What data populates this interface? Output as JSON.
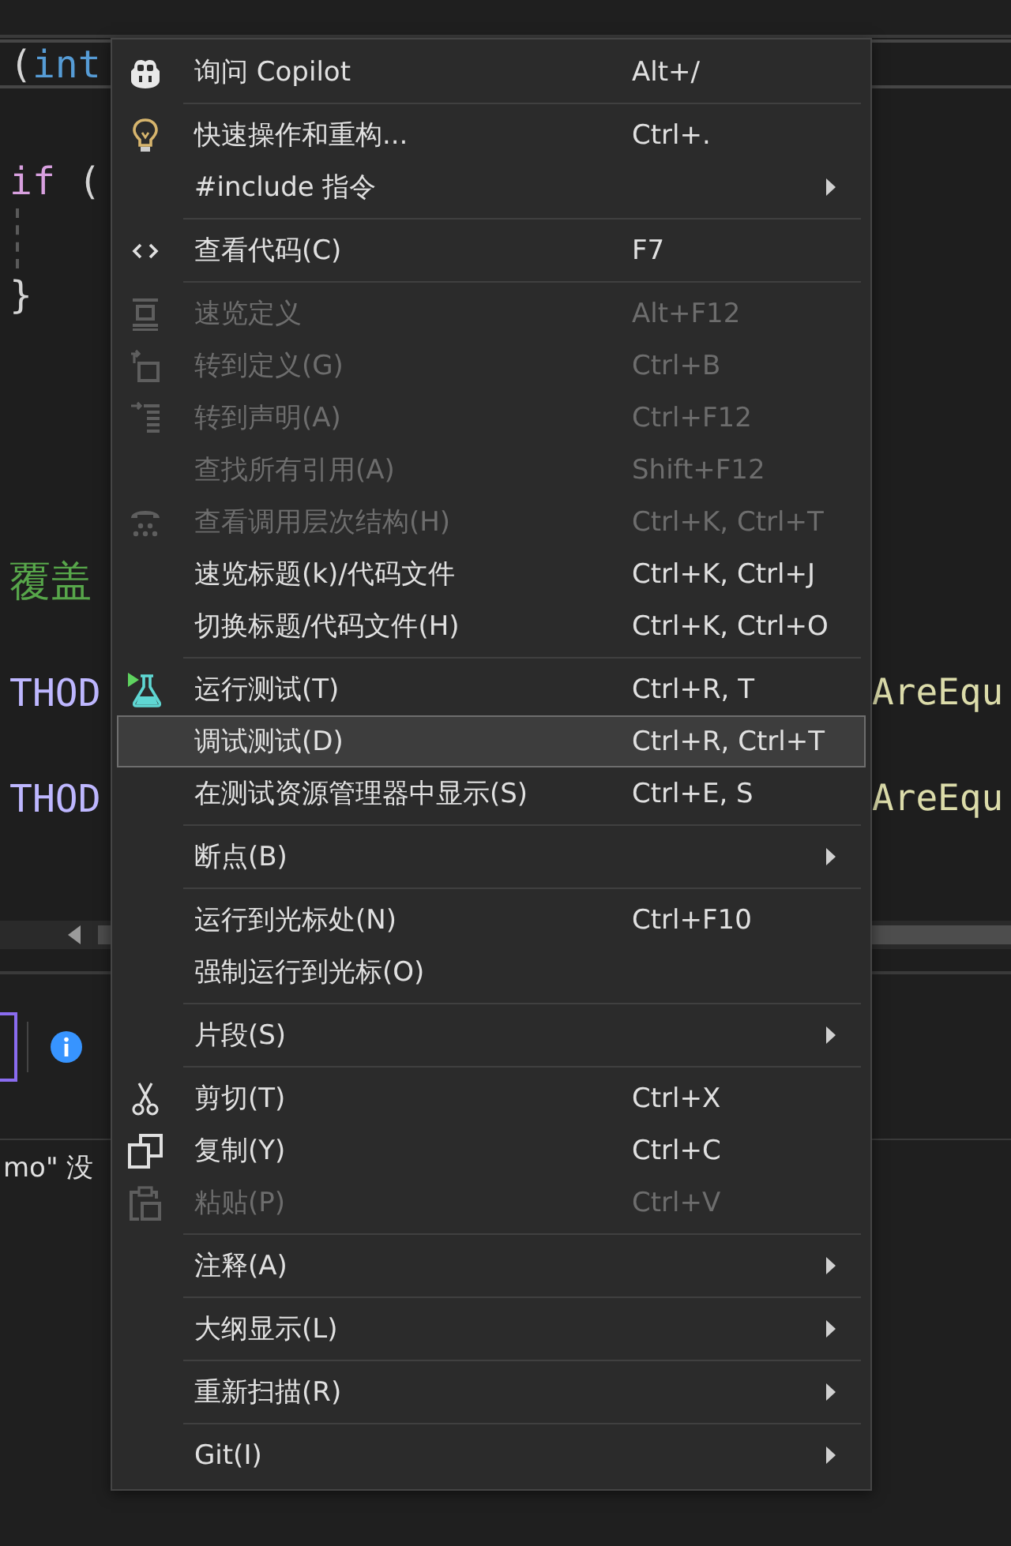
{
  "editor": {
    "lines": [
      {
        "left": [
          {
            "text": "(",
            "kind": "punct"
          },
          {
            "text": "int",
            "kind": "type"
          }
        ],
        "current": true
      },
      {
        "left": [
          {
            "text": "if",
            "kind": "keyword"
          },
          {
            "text": " (",
            "kind": "punct"
          }
        ],
        "current": false
      },
      {
        "left": [
          {
            "text": "}",
            "kind": "punct"
          }
        ],
        "current": false
      },
      {
        "left": [
          {
            "text": "覆盖",
            "kind": "comment"
          }
        ],
        "current": false
      },
      {
        "left": [
          {
            "text": "THOD",
            "kind": "macro"
          }
        ],
        "right": [
          {
            "text": "AreEqu",
            "kind": "function"
          }
        ],
        "current": false
      },
      {
        "left": [
          {
            "text": "THOD",
            "kind": "macro"
          }
        ],
        "right": [
          {
            "text": "AreEqu",
            "kind": "function"
          }
        ],
        "current": false
      }
    ]
  },
  "output_panel": {
    "message": "mo\" 没"
  },
  "context_menu": {
    "groups": [
      {
        "items": [
          {
            "label": "询问 Copilot",
            "shortcut": "Alt+/",
            "disabled": false,
            "selected": false,
            "has_submenu": false
          }
        ]
      },
      {
        "items": [
          {
            "label": "快速操作和重构...",
            "shortcut": "Ctrl+.",
            "disabled": false,
            "selected": false,
            "has_submenu": false
          },
          {
            "label": "#include 指令",
            "disabled": false,
            "selected": false,
            "has_submenu": true
          }
        ]
      },
      {
        "items": [
          {
            "label": "查看代码(C)",
            "shortcut": "F7",
            "disabled": false,
            "selected": false,
            "has_submenu": false
          }
        ]
      },
      {
        "items": [
          {
            "label": "速览定义",
            "shortcut": "Alt+F12",
            "disabled": true,
            "selected": false,
            "has_submenu": false
          },
          {
            "label": "转到定义(G)",
            "shortcut": "Ctrl+B",
            "disabled": true,
            "selected": false,
            "has_submenu": false
          },
          {
            "label": "转到声明(A)",
            "shortcut": "Ctrl+F12",
            "disabled": true,
            "selected": false,
            "has_submenu": false
          },
          {
            "label": "查找所有引用(A)",
            "shortcut": "Shift+F12",
            "disabled": true,
            "selected": false,
            "has_submenu": false
          },
          {
            "label": "查看调用层次结构(H)",
            "shortcut": "Ctrl+K, Ctrl+T",
            "disabled": true,
            "selected": false,
            "has_submenu": false
          },
          {
            "label": "速览标题(k)/代码文件",
            "shortcut": "Ctrl+K, Ctrl+J",
            "disabled": false,
            "selected": false,
            "has_submenu": false
          },
          {
            "label": "切换标题/代码文件(H)",
            "shortcut": "Ctrl+K, Ctrl+O",
            "disabled": false,
            "selected": false,
            "has_submenu": false
          }
        ]
      },
      {
        "items": [
          {
            "label": "运行测试(T)",
            "shortcut": "Ctrl+R, T",
            "disabled": false,
            "selected": false,
            "has_submenu": false
          },
          {
            "label": "调试测试(D)",
            "shortcut": "Ctrl+R, Ctrl+T",
            "disabled": false,
            "selected": true,
            "has_submenu": false
          },
          {
            "label": "在测试资源管理器中显示(S)",
            "shortcut": "Ctrl+E, S",
            "disabled": false,
            "selected": false,
            "has_submenu": false
          }
        ]
      },
      {
        "items": [
          {
            "label": "断点(B)",
            "disabled": false,
            "selected": false,
            "has_submenu": true
          }
        ]
      },
      {
        "items": [
          {
            "label": "运行到光标处(N)",
            "shortcut": "Ctrl+F10",
            "disabled": false,
            "selected": false,
            "has_submenu": false
          },
          {
            "label": "强制运行到光标(O)",
            "disabled": false,
            "selected": false,
            "has_submenu": false
          }
        ]
      },
      {
        "items": [
          {
            "label": "片段(S)",
            "disabled": false,
            "selected": false,
            "has_submenu": true
          }
        ]
      },
      {
        "items": [
          {
            "label": "剪切(T)",
            "shortcut": "Ctrl+X",
            "disabled": false,
            "selected": false,
            "has_submenu": false
          },
          {
            "label": "复制(Y)",
            "shortcut": "Ctrl+C",
            "disabled": false,
            "selected": false,
            "has_submenu": false
          },
          {
            "label": "粘贴(P)",
            "shortcut": "Ctrl+V",
            "disabled": true,
            "selected": false,
            "has_submenu": false
          }
        ]
      },
      {
        "items": [
          {
            "label": "注释(A)",
            "disabled": false,
            "selected": false,
            "has_submenu": true
          }
        ]
      },
      {
        "items": [
          {
            "label": "大纲显示(L)",
            "disabled": false,
            "selected": false,
            "has_submenu": true
          }
        ]
      },
      {
        "items": [
          {
            "label": "重新扫描(R)",
            "disabled": false,
            "selected": false,
            "has_submenu": true
          }
        ]
      },
      {
        "items": [
          {
            "label": "Git(I)",
            "disabled": false,
            "selected": false,
            "has_submenu": true
          }
        ]
      }
    ]
  }
}
